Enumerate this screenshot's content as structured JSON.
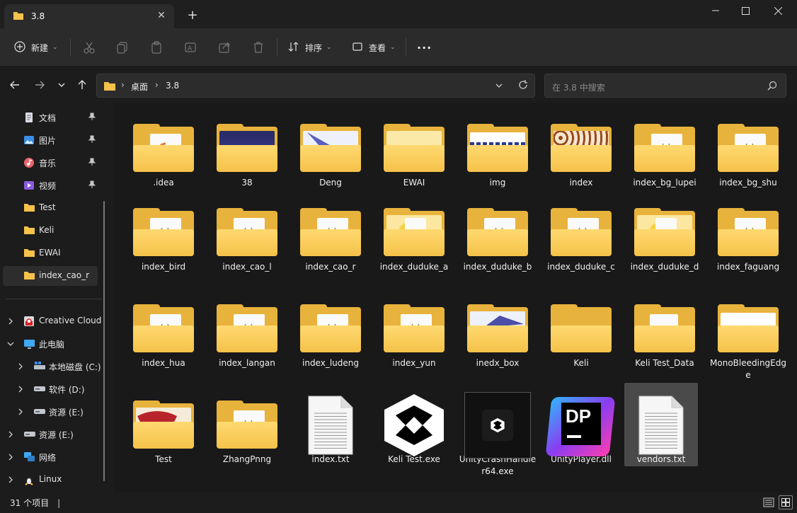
{
  "window": {
    "tab_title": "3.8",
    "close_glyph": "✕",
    "new_tab_glyph": "+"
  },
  "toolbar": {
    "new_label": "新建",
    "sort_label": "排序",
    "view_label": "查看",
    "more_glyph": "···"
  },
  "address": {
    "crumbs": [
      "桌面",
      "3.8"
    ],
    "search_placeholder": "在 3.8 中搜索"
  },
  "sidebar": {
    "quick": [
      {
        "label": "文档",
        "icon": "document-icon",
        "pinned": true
      },
      {
        "label": "图片",
        "icon": "pictures-icon",
        "pinned": true
      },
      {
        "label": "音乐",
        "icon": "music-icon",
        "pinned": true
      },
      {
        "label": "视频",
        "icon": "video-icon",
        "pinned": true
      },
      {
        "label": "Test",
        "icon": "folder-icon",
        "pinned": false
      },
      {
        "label": "Keli",
        "icon": "folder-icon",
        "pinned": false
      },
      {
        "label": "EWAI",
        "icon": "folder-icon",
        "pinned": false
      },
      {
        "label": "index_cao_r",
        "icon": "folder-icon",
        "pinned": false
      }
    ],
    "tree": [
      {
        "label": "Creative Cloud",
        "icon": "creative-cloud-icon",
        "expanded": false,
        "level": 0
      },
      {
        "label": "此电脑",
        "icon": "computer-icon",
        "expanded": true,
        "level": 0
      },
      {
        "label": "本地磁盘 (C:)",
        "icon": "drive-c-icon",
        "expanded": false,
        "level": 1
      },
      {
        "label": "软件 (D:)",
        "icon": "drive-icon",
        "expanded": false,
        "level": 1
      },
      {
        "label": "资源 (E:)",
        "icon": "drive-icon",
        "expanded": false,
        "level": 1
      },
      {
        "label": "资源 (E:)",
        "icon": "drive-icon",
        "expanded": false,
        "level": 0
      },
      {
        "label": "网络",
        "icon": "network-icon",
        "expanded": false,
        "level": 0
      },
      {
        "label": "Linux",
        "icon": "linux-icon",
        "expanded": false,
        "level": 0
      }
    ]
  },
  "files": [
    {
      "name": ".idea",
      "kind": "folder",
      "art": "doc-orange"
    },
    {
      "name": "38",
      "kind": "folder",
      "art": "dark-image"
    },
    {
      "name": "Deng",
      "kind": "folder",
      "art": "blue-swoosh"
    },
    {
      "name": "EWAI",
      "kind": "folder",
      "art": "blank"
    },
    {
      "name": "img",
      "kind": "folder",
      "art": "text-banner"
    },
    {
      "name": "index",
      "kind": "folder",
      "art": "pattern"
    },
    {
      "name": "index_bg_lupei",
      "kind": "folder",
      "art": "doc"
    },
    {
      "name": "index_bg_shu",
      "kind": "folder",
      "art": "doc"
    },
    {
      "name": "index_bird",
      "kind": "folder",
      "art": "doc"
    },
    {
      "name": "index_cao_l",
      "kind": "folder",
      "art": "doc"
    },
    {
      "name": "index_cao_r",
      "kind": "folder",
      "art": "doc"
    },
    {
      "name": "index_duduke_a",
      "kind": "folder",
      "art": "yellow-splash"
    },
    {
      "name": "index_duduke_b",
      "kind": "folder",
      "art": "doc"
    },
    {
      "name": "index_duduke_c",
      "kind": "folder",
      "art": "doc"
    },
    {
      "name": "index_duduke_d",
      "kind": "folder",
      "art": "yellow-splash"
    },
    {
      "name": "index_faguang",
      "kind": "folder",
      "art": "doc"
    },
    {
      "name": "index_hua",
      "kind": "folder",
      "art": "doc"
    },
    {
      "name": "index_langan",
      "kind": "folder",
      "art": "doc"
    },
    {
      "name": "index_ludeng",
      "kind": "folder",
      "art": "doc"
    },
    {
      "name": "index_yun",
      "kind": "folder",
      "art": "doc"
    },
    {
      "name": "inedx_box",
      "kind": "folder",
      "art": "blue-swoosh2"
    },
    {
      "name": "Keli",
      "kind": "folder",
      "art": "empty"
    },
    {
      "name": "Keli Test_Data",
      "kind": "folder",
      "art": "paper"
    },
    {
      "name": "MonoBleedingEdge",
      "kind": "folder",
      "art": "empty-white"
    },
    {
      "name": "Test",
      "kind": "folder",
      "art": "red"
    },
    {
      "name": "ZhangPnng",
      "kind": "folder",
      "art": "doc"
    },
    {
      "name": "index.txt",
      "kind": "txt"
    },
    {
      "name": "Keli Test.exe",
      "kind": "unity"
    },
    {
      "name": "UnityCrashHandler64.exe",
      "kind": "unity-crash"
    },
    {
      "name": "UnityPlayer.dll",
      "kind": "dp"
    },
    {
      "name": "vendors.txt",
      "kind": "txt"
    }
  ],
  "status": {
    "count_text": "31 个项目",
    "cursor": "|"
  },
  "colors": {
    "folder": "#f5c24a",
    "accent": "#4cc2ff"
  }
}
